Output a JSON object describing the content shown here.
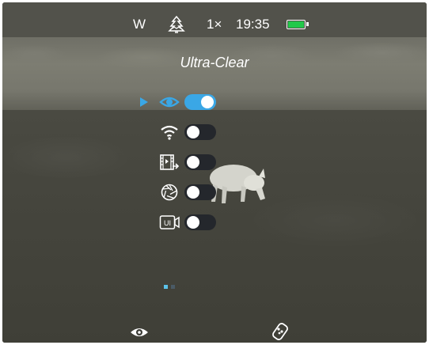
{
  "status_bar": {
    "wind_label": "W",
    "zoom": "1×",
    "time": "19:35",
    "icons": [
      "forest-icon",
      "battery-icon"
    ],
    "battery_color": "#22c84a"
  },
  "mode_title": "Ultra-Clear",
  "menu": {
    "accent_color": "#3aa7e6",
    "items": [
      {
        "icon": "eye-icon",
        "enabled": true,
        "selected": true
      },
      {
        "icon": "wifi-icon",
        "enabled": false,
        "selected": false
      },
      {
        "icon": "video-export-icon",
        "enabled": false,
        "selected": false
      },
      {
        "icon": "aperture-icon",
        "enabled": false,
        "selected": false
      },
      {
        "icon": "ui-record-icon",
        "enabled": false,
        "selected": false
      }
    ]
  },
  "pager": {
    "current": 1,
    "total": 2
  },
  "bottom_bar": {
    "icons": [
      "eye-icon",
      "remote-icon"
    ]
  }
}
